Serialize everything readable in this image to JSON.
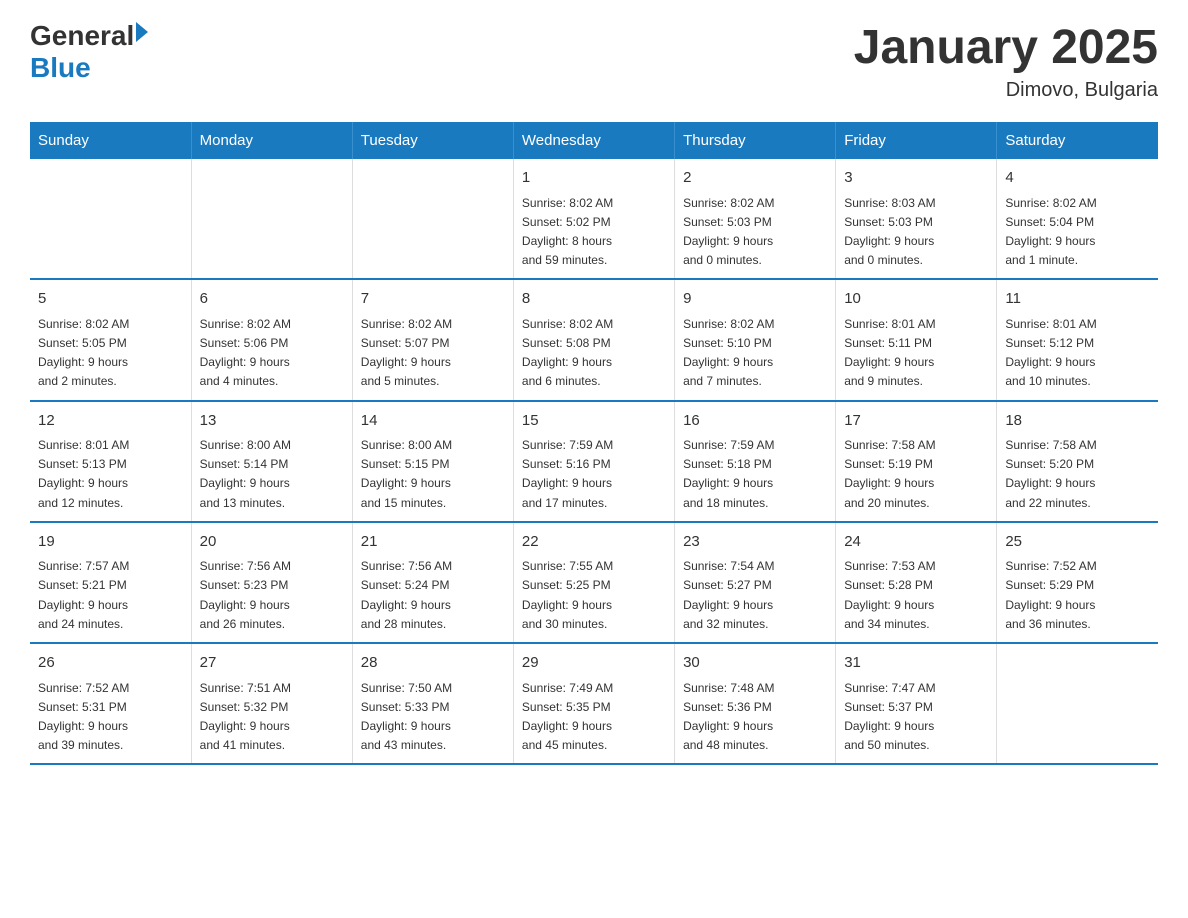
{
  "header": {
    "logo_general": "General",
    "logo_blue": "Blue",
    "month_title": "January 2025",
    "location": "Dimovo, Bulgaria"
  },
  "days_of_week": [
    "Sunday",
    "Monday",
    "Tuesday",
    "Wednesday",
    "Thursday",
    "Friday",
    "Saturday"
  ],
  "weeks": [
    [
      {
        "day": "",
        "info": ""
      },
      {
        "day": "",
        "info": ""
      },
      {
        "day": "",
        "info": ""
      },
      {
        "day": "1",
        "info": "Sunrise: 8:02 AM\nSunset: 5:02 PM\nDaylight: 8 hours\nand 59 minutes."
      },
      {
        "day": "2",
        "info": "Sunrise: 8:02 AM\nSunset: 5:03 PM\nDaylight: 9 hours\nand 0 minutes."
      },
      {
        "day": "3",
        "info": "Sunrise: 8:03 AM\nSunset: 5:03 PM\nDaylight: 9 hours\nand 0 minutes."
      },
      {
        "day": "4",
        "info": "Sunrise: 8:02 AM\nSunset: 5:04 PM\nDaylight: 9 hours\nand 1 minute."
      }
    ],
    [
      {
        "day": "5",
        "info": "Sunrise: 8:02 AM\nSunset: 5:05 PM\nDaylight: 9 hours\nand 2 minutes."
      },
      {
        "day": "6",
        "info": "Sunrise: 8:02 AM\nSunset: 5:06 PM\nDaylight: 9 hours\nand 4 minutes."
      },
      {
        "day": "7",
        "info": "Sunrise: 8:02 AM\nSunset: 5:07 PM\nDaylight: 9 hours\nand 5 minutes."
      },
      {
        "day": "8",
        "info": "Sunrise: 8:02 AM\nSunset: 5:08 PM\nDaylight: 9 hours\nand 6 minutes."
      },
      {
        "day": "9",
        "info": "Sunrise: 8:02 AM\nSunset: 5:10 PM\nDaylight: 9 hours\nand 7 minutes."
      },
      {
        "day": "10",
        "info": "Sunrise: 8:01 AM\nSunset: 5:11 PM\nDaylight: 9 hours\nand 9 minutes."
      },
      {
        "day": "11",
        "info": "Sunrise: 8:01 AM\nSunset: 5:12 PM\nDaylight: 9 hours\nand 10 minutes."
      }
    ],
    [
      {
        "day": "12",
        "info": "Sunrise: 8:01 AM\nSunset: 5:13 PM\nDaylight: 9 hours\nand 12 minutes."
      },
      {
        "day": "13",
        "info": "Sunrise: 8:00 AM\nSunset: 5:14 PM\nDaylight: 9 hours\nand 13 minutes."
      },
      {
        "day": "14",
        "info": "Sunrise: 8:00 AM\nSunset: 5:15 PM\nDaylight: 9 hours\nand 15 minutes."
      },
      {
        "day": "15",
        "info": "Sunrise: 7:59 AM\nSunset: 5:16 PM\nDaylight: 9 hours\nand 17 minutes."
      },
      {
        "day": "16",
        "info": "Sunrise: 7:59 AM\nSunset: 5:18 PM\nDaylight: 9 hours\nand 18 minutes."
      },
      {
        "day": "17",
        "info": "Sunrise: 7:58 AM\nSunset: 5:19 PM\nDaylight: 9 hours\nand 20 minutes."
      },
      {
        "day": "18",
        "info": "Sunrise: 7:58 AM\nSunset: 5:20 PM\nDaylight: 9 hours\nand 22 minutes."
      }
    ],
    [
      {
        "day": "19",
        "info": "Sunrise: 7:57 AM\nSunset: 5:21 PM\nDaylight: 9 hours\nand 24 minutes."
      },
      {
        "day": "20",
        "info": "Sunrise: 7:56 AM\nSunset: 5:23 PM\nDaylight: 9 hours\nand 26 minutes."
      },
      {
        "day": "21",
        "info": "Sunrise: 7:56 AM\nSunset: 5:24 PM\nDaylight: 9 hours\nand 28 minutes."
      },
      {
        "day": "22",
        "info": "Sunrise: 7:55 AM\nSunset: 5:25 PM\nDaylight: 9 hours\nand 30 minutes."
      },
      {
        "day": "23",
        "info": "Sunrise: 7:54 AM\nSunset: 5:27 PM\nDaylight: 9 hours\nand 32 minutes."
      },
      {
        "day": "24",
        "info": "Sunrise: 7:53 AM\nSunset: 5:28 PM\nDaylight: 9 hours\nand 34 minutes."
      },
      {
        "day": "25",
        "info": "Sunrise: 7:52 AM\nSunset: 5:29 PM\nDaylight: 9 hours\nand 36 minutes."
      }
    ],
    [
      {
        "day": "26",
        "info": "Sunrise: 7:52 AM\nSunset: 5:31 PM\nDaylight: 9 hours\nand 39 minutes."
      },
      {
        "day": "27",
        "info": "Sunrise: 7:51 AM\nSunset: 5:32 PM\nDaylight: 9 hours\nand 41 minutes."
      },
      {
        "day": "28",
        "info": "Sunrise: 7:50 AM\nSunset: 5:33 PM\nDaylight: 9 hours\nand 43 minutes."
      },
      {
        "day": "29",
        "info": "Sunrise: 7:49 AM\nSunset: 5:35 PM\nDaylight: 9 hours\nand 45 minutes."
      },
      {
        "day": "30",
        "info": "Sunrise: 7:48 AM\nSunset: 5:36 PM\nDaylight: 9 hours\nand 48 minutes."
      },
      {
        "day": "31",
        "info": "Sunrise: 7:47 AM\nSunset: 5:37 PM\nDaylight: 9 hours\nand 50 minutes."
      },
      {
        "day": "",
        "info": ""
      }
    ]
  ]
}
